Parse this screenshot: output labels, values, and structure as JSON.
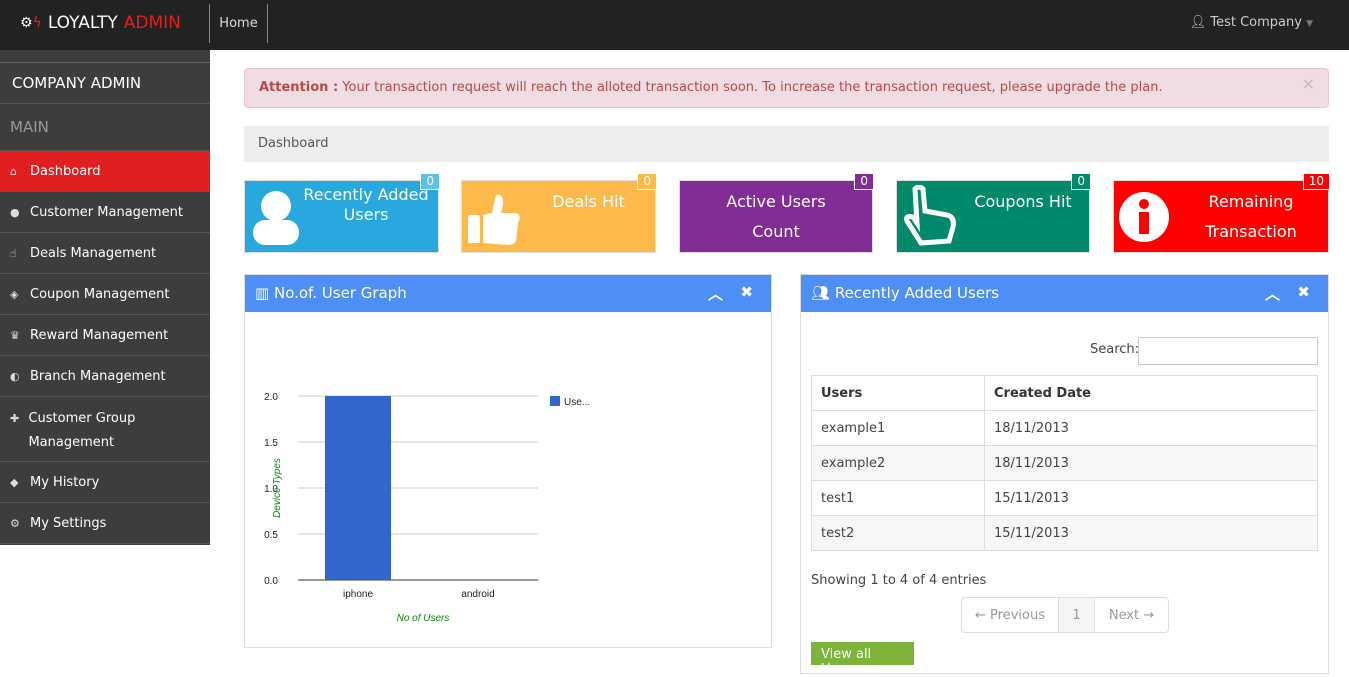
{
  "header": {
    "brand_main": "LOYALTY",
    "brand_accent": "ADMIN",
    "home": "Home",
    "user": "Test Company"
  },
  "sidebar": {
    "title": "COMPANY ADMIN",
    "section": "MAIN",
    "items": [
      {
        "label": "Dashboard",
        "icon": "home-icon"
      },
      {
        "label": "Customer Management",
        "icon": "user-icon"
      },
      {
        "label": "Deals Management",
        "icon": "thumbs-up-icon"
      },
      {
        "label": "Coupon Management",
        "icon": "ticket-icon"
      },
      {
        "label": "Reward Management",
        "icon": "trophy-icon"
      },
      {
        "label": "Branch Management",
        "icon": "dashboard-icon"
      },
      {
        "label": "Customer Group Management",
        "icon": "puzzle-icon"
      },
      {
        "label": "My History",
        "icon": "tag-icon"
      },
      {
        "label": "My Settings",
        "icon": "cogs-icon"
      }
    ]
  },
  "alert": {
    "title": "Attention :",
    "message": "Your transaction request will reach the alloted transaction soon. To increase the transaction request, please upgrade the plan.",
    "close": "×"
  },
  "breadcrumb": "Dashboard",
  "tiles": [
    {
      "label": "Recently Added Users",
      "count": "0",
      "color": "#29a8e0"
    },
    {
      "label": "Deals Hit",
      "count": "0",
      "color": "#fdb94a"
    },
    {
      "label": "Active Users Count",
      "count": "0",
      "color": "#822c95"
    },
    {
      "label": "Coupons Hit",
      "count": "0",
      "color": "#00896a"
    },
    {
      "label": "Remaining Transaction",
      "count": "10",
      "color": "#ff0000"
    }
  ],
  "graph_panel": {
    "title": "No.of. User Graph"
  },
  "users_panel": {
    "title": "Recently Added Users",
    "search_label": "Search:",
    "search_value": "",
    "columns": [
      "Users",
      "Created Date"
    ],
    "rows": [
      [
        "example1",
        "18/11/2013"
      ],
      [
        "example2",
        "18/11/2013"
      ],
      [
        "test1",
        "15/11/2013"
      ],
      [
        "test2",
        "15/11/2013"
      ]
    ],
    "info": "Showing 1 to 4 of 4 entries",
    "prev": "← Previous",
    "page": "1",
    "next": "Next →",
    "view_all": "View all Users"
  },
  "chart_data": {
    "type": "bar",
    "categories": [
      "iphone",
      "android"
    ],
    "values": [
      2,
      0
    ],
    "series_name": "Use...",
    "xlabel": "No of Users",
    "ylabel": "Device Types",
    "ylim": [
      0,
      2
    ],
    "yticks": [
      "0.0",
      "0.5",
      "1.0",
      "1.5",
      "2.0"
    ],
    "legend": "right",
    "color": "#3366cc"
  }
}
